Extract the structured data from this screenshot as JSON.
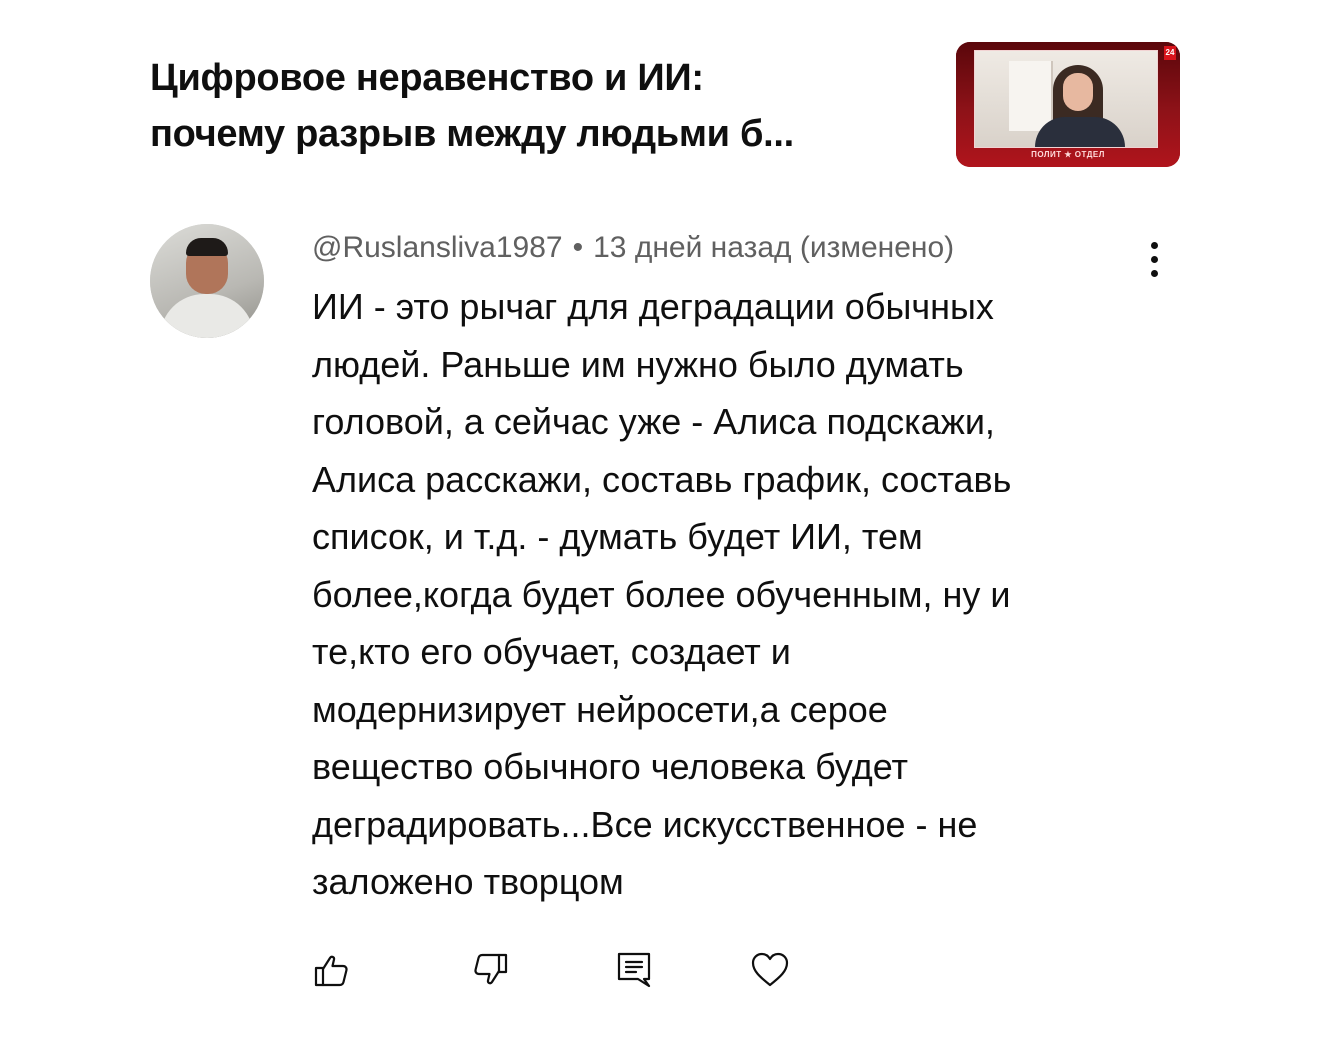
{
  "video": {
    "title_line1": "Цифровое неравенство и ИИ:",
    "title_line2": "почему разрыв между людьми б...",
    "thumbnail": {
      "badge": "24",
      "logo_text": "ПОЛИТ ★ ОТДЕЛ",
      "colors": {
        "primary": "#8e1218",
        "accent": "#d8141c"
      }
    }
  },
  "comment": {
    "author": "@Ruslansliva1987",
    "separator": "•",
    "time": "13 дней назад (изменено)",
    "text": "ИИ - это рычаг для деградации обычных\nлюдей. Раньше им нужно было думать\nголовой, а сейчас уже - Алиса подскажи,\nАлиса расскажи, составь график, составь\nсписок, и т.д. - думать будет ИИ, тем\nболее,когда будет более обученным, ну и\nте,кто его обучает, создает и\nмодернизирует нейросети,а серое\nвещество обычного человека будет\nдеградировать...Все искусственное - не\nзаложено творцом",
    "actions": [
      {
        "icon": "thumbs-up-icon"
      },
      {
        "icon": "thumbs-down-icon"
      },
      {
        "icon": "reply-icon"
      },
      {
        "icon": "heart-icon"
      }
    ],
    "more_icon": "more-vertical-icon"
  },
  "colors": {
    "text_primary": "#0f0f0f",
    "text_secondary": "#606060",
    "background": "#ffffff"
  }
}
